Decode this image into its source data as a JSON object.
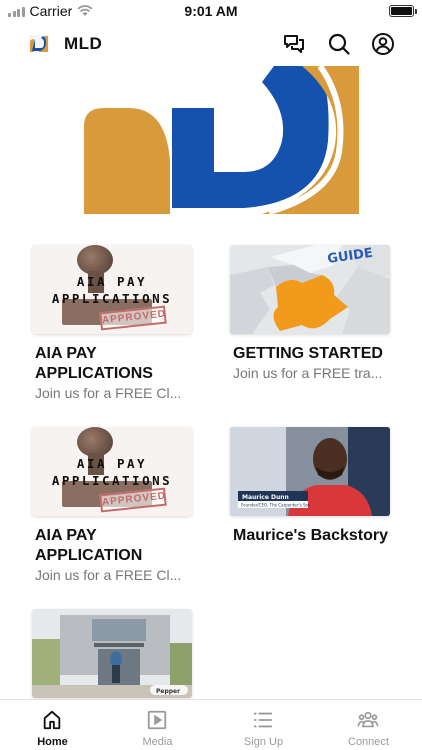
{
  "status_bar": {
    "carrier": "Carrier",
    "time": "9:01 AM",
    "battery_level": 1.0
  },
  "header": {
    "title": "MLD",
    "icons": [
      "chat-icon",
      "search-icon",
      "profile-icon"
    ]
  },
  "brand_colors": {
    "orange": "#D89A3A",
    "blue": "#1552AD"
  },
  "cards": [
    {
      "thumb_text": [
        "AIA PAY",
        "APPLICATIONS"
      ],
      "stamp_text": "APPROVED",
      "title": "AIA PAY APPLICATIONS",
      "subtitle": "Join us for a FREE Cl..."
    },
    {
      "thumb_text": [
        "GUIDE"
      ],
      "title": "GETTING STARTED",
      "subtitle": "Join us for a FREE tra..."
    },
    {
      "thumb_text": [
        "AIA PAY",
        "APPLICATIONS"
      ],
      "stamp_text": "APPROVED",
      "title": "AIA PAY APPLICATION",
      "subtitle": "Join us for a FREE Cl..."
    },
    {
      "thumb_text": [
        "Maurice Dunn",
        "Founder/CEO, The Carpenter's Son"
      ],
      "title": "Maurice's Backstory",
      "subtitle": ""
    },
    {
      "thumb_text": [
        "Pepper"
      ],
      "title": "",
      "subtitle": ""
    }
  ],
  "tabs": [
    {
      "label": "Home",
      "icon": "home-icon",
      "active": true
    },
    {
      "label": "Media",
      "icon": "play-icon",
      "active": false
    },
    {
      "label": "Sign Up",
      "icon": "list-icon",
      "active": false
    },
    {
      "label": "Connect",
      "icon": "people-icon",
      "active": false
    }
  ]
}
